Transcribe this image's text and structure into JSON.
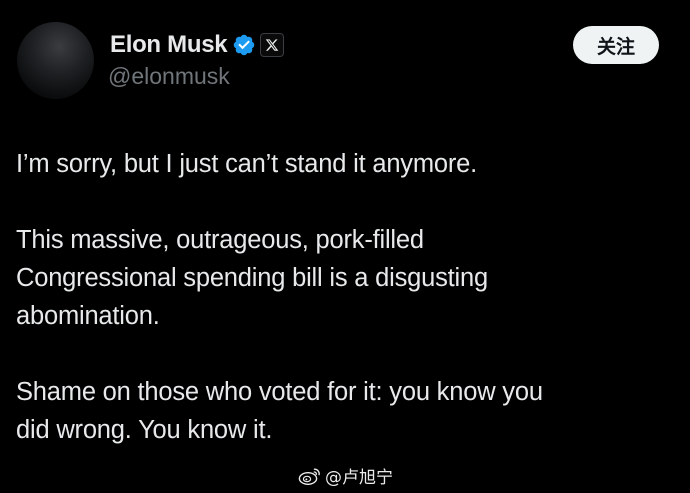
{
  "profile": {
    "display_name": "Elon Musk",
    "handle": "@elonmusk",
    "avatar_icon": "avatar-dark-photo",
    "verified_icon": "verified-badge-icon",
    "affiliation_icon": "x-logo-icon"
  },
  "actions": {
    "follow_label": "关注"
  },
  "tweet": {
    "paragraphs": [
      {
        "lines": [
          "I’m sorry, but I just can’t stand it anymore."
        ]
      },
      {
        "lines": [
          "This massive, outrageous, pork-filled",
          "Congressional spending bill is a disgusting",
          "abomination."
        ]
      },
      {
        "lines": [
          "Shame on those who voted for it: you know you",
          "did wrong. You know it."
        ]
      }
    ]
  },
  "watermark": {
    "text": "@卢旭宁",
    "icon": "weibo-logo-icon"
  },
  "colors": {
    "background": "#000000",
    "text_primary": "#e7e9ea",
    "text_secondary": "#71767b",
    "verified_blue": "#1d9bf0",
    "button_bg": "#eff3f4",
    "button_text": "#0f1419"
  }
}
